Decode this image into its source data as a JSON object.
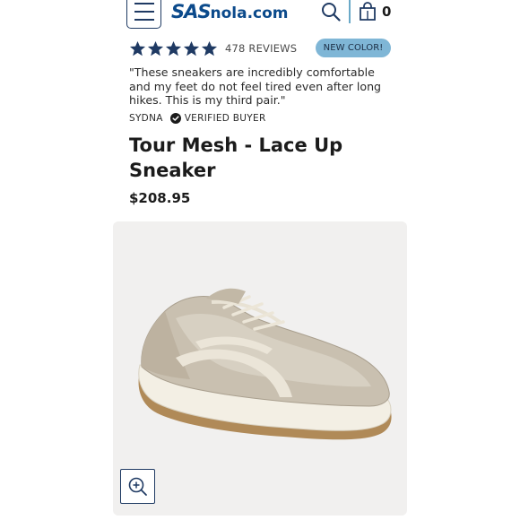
{
  "header": {
    "logo_brand": "SAS",
    "logo_domain": "nola.com",
    "cart_count": "0",
    "menu_icon": "hamburger-menu-icon",
    "search_icon": "search-icon",
    "cart_icon": "shopping-bag-icon"
  },
  "rating": {
    "stars": 5,
    "reviews_label": "478 REVIEWS",
    "badge": "NEW COLOR!"
  },
  "review": {
    "quote": "\"These sneakers are incredibly comfortable and my feet do not feel tired even after long hikes. This is my third pair.\"",
    "reviewer": "SYDNA",
    "verified_label": "VERIFIED BUYER"
  },
  "product": {
    "title": "Tour Mesh - Lace Up Sneaker",
    "price": "$208.95",
    "zoom_icon": "zoom-in-icon"
  },
  "colors": {
    "brand_blue": "#0b4a8b",
    "star_navy": "#1f3a63",
    "badge_bg": "#7fb6d6",
    "image_bg": "#f1f0ef"
  }
}
